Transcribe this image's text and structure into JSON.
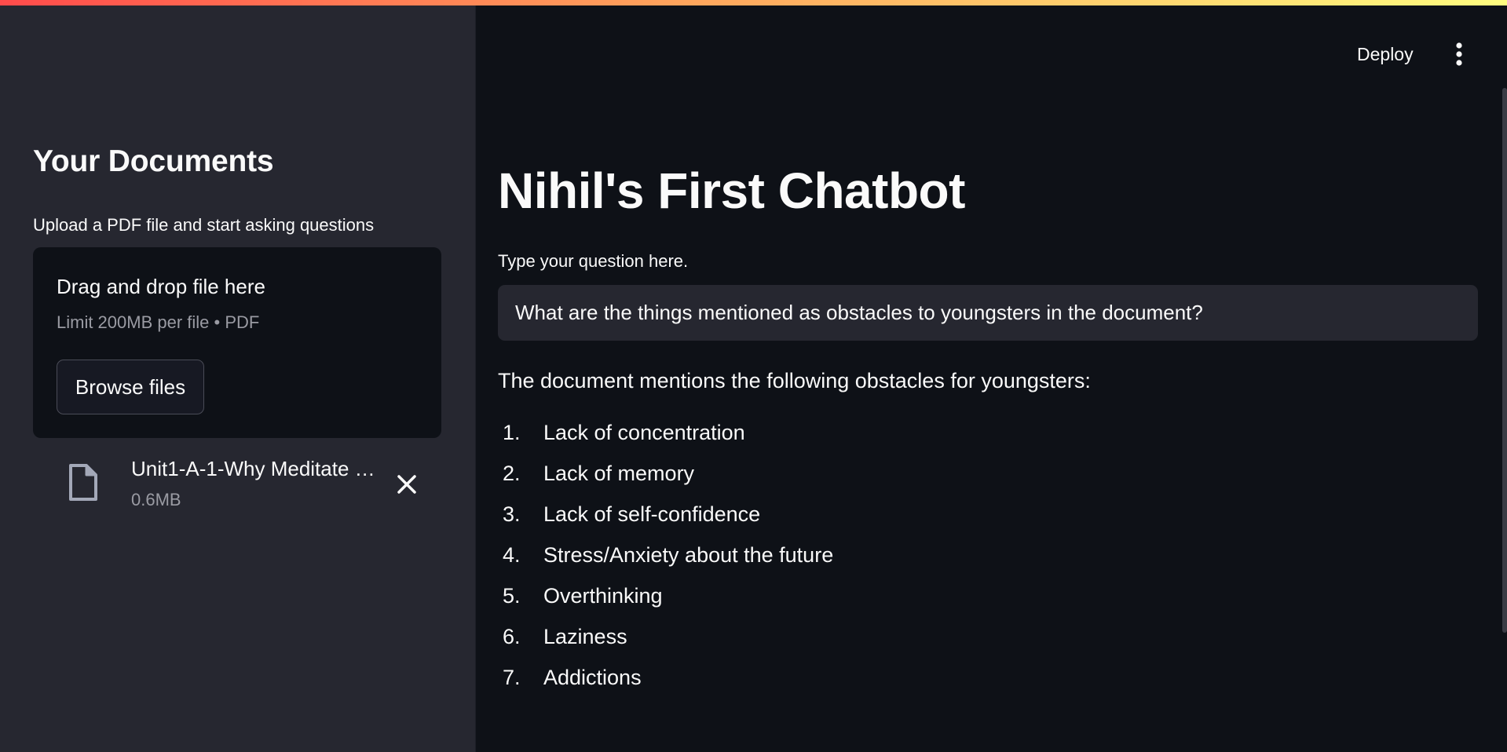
{
  "header": {
    "deploy_label": "Deploy",
    "menu_icon": "vertical-ellipsis-icon"
  },
  "sidebar": {
    "title": "Your Documents",
    "uploader": {
      "label": "Upload a PDF file and start asking questions",
      "drop_title": "Drag and drop file here",
      "limit_text": "Limit 200MB per file • PDF",
      "browse_label": "Browse files"
    },
    "file": {
      "name": "Unit1-A-1-Why Meditate …",
      "size": "0.6MB",
      "icon": "document-icon",
      "remove_icon": "close-icon"
    }
  },
  "main": {
    "title": "Nihil's First Chatbot",
    "question_label": "Type your question here.",
    "question_value": "What are the things mentioned as obstacles to youngsters in the document?",
    "answer_intro": "The document mentions the following obstacles for youngsters:",
    "answer_items": [
      {
        "num": "1.",
        "text": "Lack of concentration"
      },
      {
        "num": "2.",
        "text": "Lack of memory"
      },
      {
        "num": "3.",
        "text": "Lack of self-confidence"
      },
      {
        "num": "4.",
        "text": "Stress/Anxiety about the future"
      },
      {
        "num": "5.",
        "text": "Overthinking"
      },
      {
        "num": "6.",
        "text": "Laziness"
      },
      {
        "num": "7.",
        "text": "Addictions"
      }
    ]
  },
  "colors": {
    "background": "#0e1117",
    "sidebar": "#262730",
    "input": "#262730",
    "text": "#fafafa",
    "muted": "#9a9ba3",
    "accent_gradient": [
      "#ff4b4b",
      "#fffd80"
    ]
  }
}
